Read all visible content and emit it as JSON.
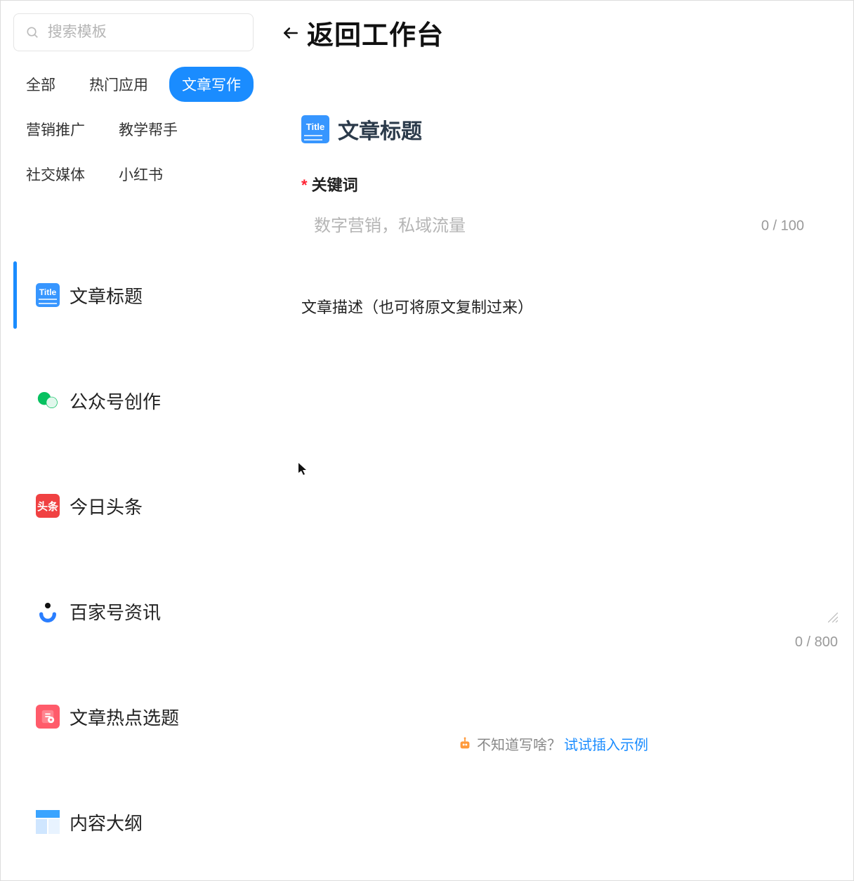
{
  "sidebar": {
    "search_placeholder": "搜索模板",
    "categories": [
      {
        "id": "all",
        "label": "全部"
      },
      {
        "id": "hot",
        "label": "热门应用"
      },
      {
        "id": "writing",
        "label": "文章写作",
        "active": true
      },
      {
        "id": "marketing",
        "label": "营销推广"
      },
      {
        "id": "teaching",
        "label": "教学帮手"
      },
      {
        "id": "social",
        "label": "社交媒体"
      },
      {
        "id": "xhs",
        "label": "小红书"
      }
    ],
    "templates": [
      {
        "id": "title",
        "label": "文章标题",
        "icon": "title",
        "active": true
      },
      {
        "id": "wechat",
        "label": "公众号创作",
        "icon": "wechat"
      },
      {
        "id": "toutiao",
        "label": "今日头条",
        "icon": "toutiao",
        "iconText": "头条"
      },
      {
        "id": "baijia",
        "label": "百家号资讯",
        "icon": "baijia"
      },
      {
        "id": "hotspot",
        "label": "文章热点选题",
        "icon": "hot"
      },
      {
        "id": "outline",
        "label": "内容大纲",
        "icon": "outline"
      }
    ]
  },
  "header": {
    "back_label": "返回工作台"
  },
  "form": {
    "title": "文章标题",
    "keyword": {
      "label": "关键词",
      "required": "*",
      "placeholder": "数字营销，私域流量",
      "value": "",
      "counter": "0 / 100",
      "max": 100
    },
    "description": {
      "label": "文章描述（也可将原文复制过来）",
      "value": "",
      "counter": "0 / 800",
      "max": 800
    }
  },
  "hint": {
    "question": "不知道写啥？",
    "action": "试试插入示例"
  },
  "colors": {
    "primary": "#1a8cff",
    "danger": "#f23",
    "toutiaoRed": "#f04142",
    "hotPink": "#ff5b6a"
  }
}
